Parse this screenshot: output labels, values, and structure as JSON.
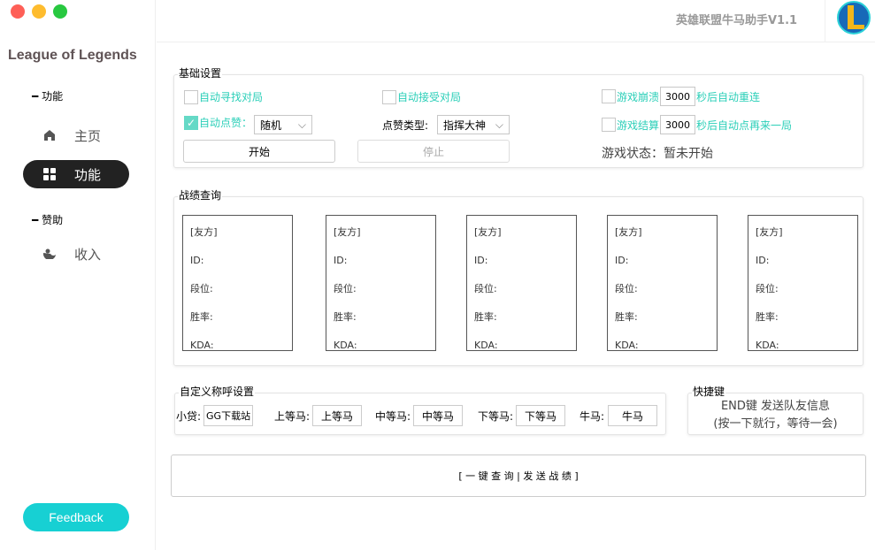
{
  "window": {
    "controls": [
      "close",
      "minimize",
      "maximize"
    ]
  },
  "sidebar": {
    "brand": "League of Legends",
    "sections": [
      {
        "label": "功能",
        "items": [
          {
            "label": "主页",
            "icon": "home-icon"
          },
          {
            "label": "功能",
            "icon": "grid-icon",
            "active": true
          }
        ]
      },
      {
        "label": "赞助",
        "items": [
          {
            "label": "收入",
            "icon": "income-icon"
          }
        ]
      }
    ],
    "feedback": "Feedback"
  },
  "header": {
    "title": "英雄联盟牛马助手V1.1"
  },
  "basic": {
    "title": "基础设置",
    "auto_find": "自动寻找对局",
    "auto_accept": "自动接受对局",
    "crash_label": "游戏崩溃",
    "crash_value": "3000",
    "crash_suffix": "秒后自动重连",
    "auto_like": "自动点赞：",
    "auto_like_checked": true,
    "like_mode": "随机",
    "like_type_label": "点赞类型:",
    "like_type": "指挥大神",
    "end_label": "游戏结算",
    "end_value": "3000",
    "end_suffix": "秒后自动点再来一局",
    "start": "开始",
    "stop": "停止",
    "status": "游戏状态：暂未开始"
  },
  "records": {
    "title": "战绩查询",
    "cards": [
      {
        "side": "[友方]",
        "id": "ID:",
        "rank": "段位:",
        "winrate": "胜率:",
        "kda": "KDA:"
      },
      {
        "side": "[友方]",
        "id": "ID:",
        "rank": "段位:",
        "winrate": "胜率:",
        "kda": "KDA:"
      },
      {
        "side": "[友方]",
        "id": "ID:",
        "rank": "段位:",
        "winrate": "胜率:",
        "kda": "KDA:"
      },
      {
        "side": "[友方]",
        "id": "ID:",
        "rank": "段位:",
        "winrate": "胜率:",
        "kda": "KDA:"
      },
      {
        "side": "[友方]",
        "id": "ID:",
        "rank": "段位:",
        "winrate": "胜率:",
        "kda": "KDA:"
      }
    ]
  },
  "names": {
    "title": "自定义称呼设置",
    "fields": [
      {
        "label": "小贷:",
        "value": "GG下载站"
      },
      {
        "label": "上等马:",
        "value": "上等马"
      },
      {
        "label": "中等马:",
        "value": "中等马"
      },
      {
        "label": "下等马:",
        "value": "下等马"
      },
      {
        "label": "牛马:",
        "value": "牛马"
      }
    ]
  },
  "shortcut": {
    "title": "快捷键",
    "line1": "END键 发送队友信息",
    "line2": "(按一下就行，等待一会)"
  },
  "query_button": "[ 一 键 查 询 | 发 送 战 绩 ]",
  "colors": {
    "accent": "#17d0d3",
    "check": "#2bcfb8",
    "active_nav": "#222222"
  }
}
